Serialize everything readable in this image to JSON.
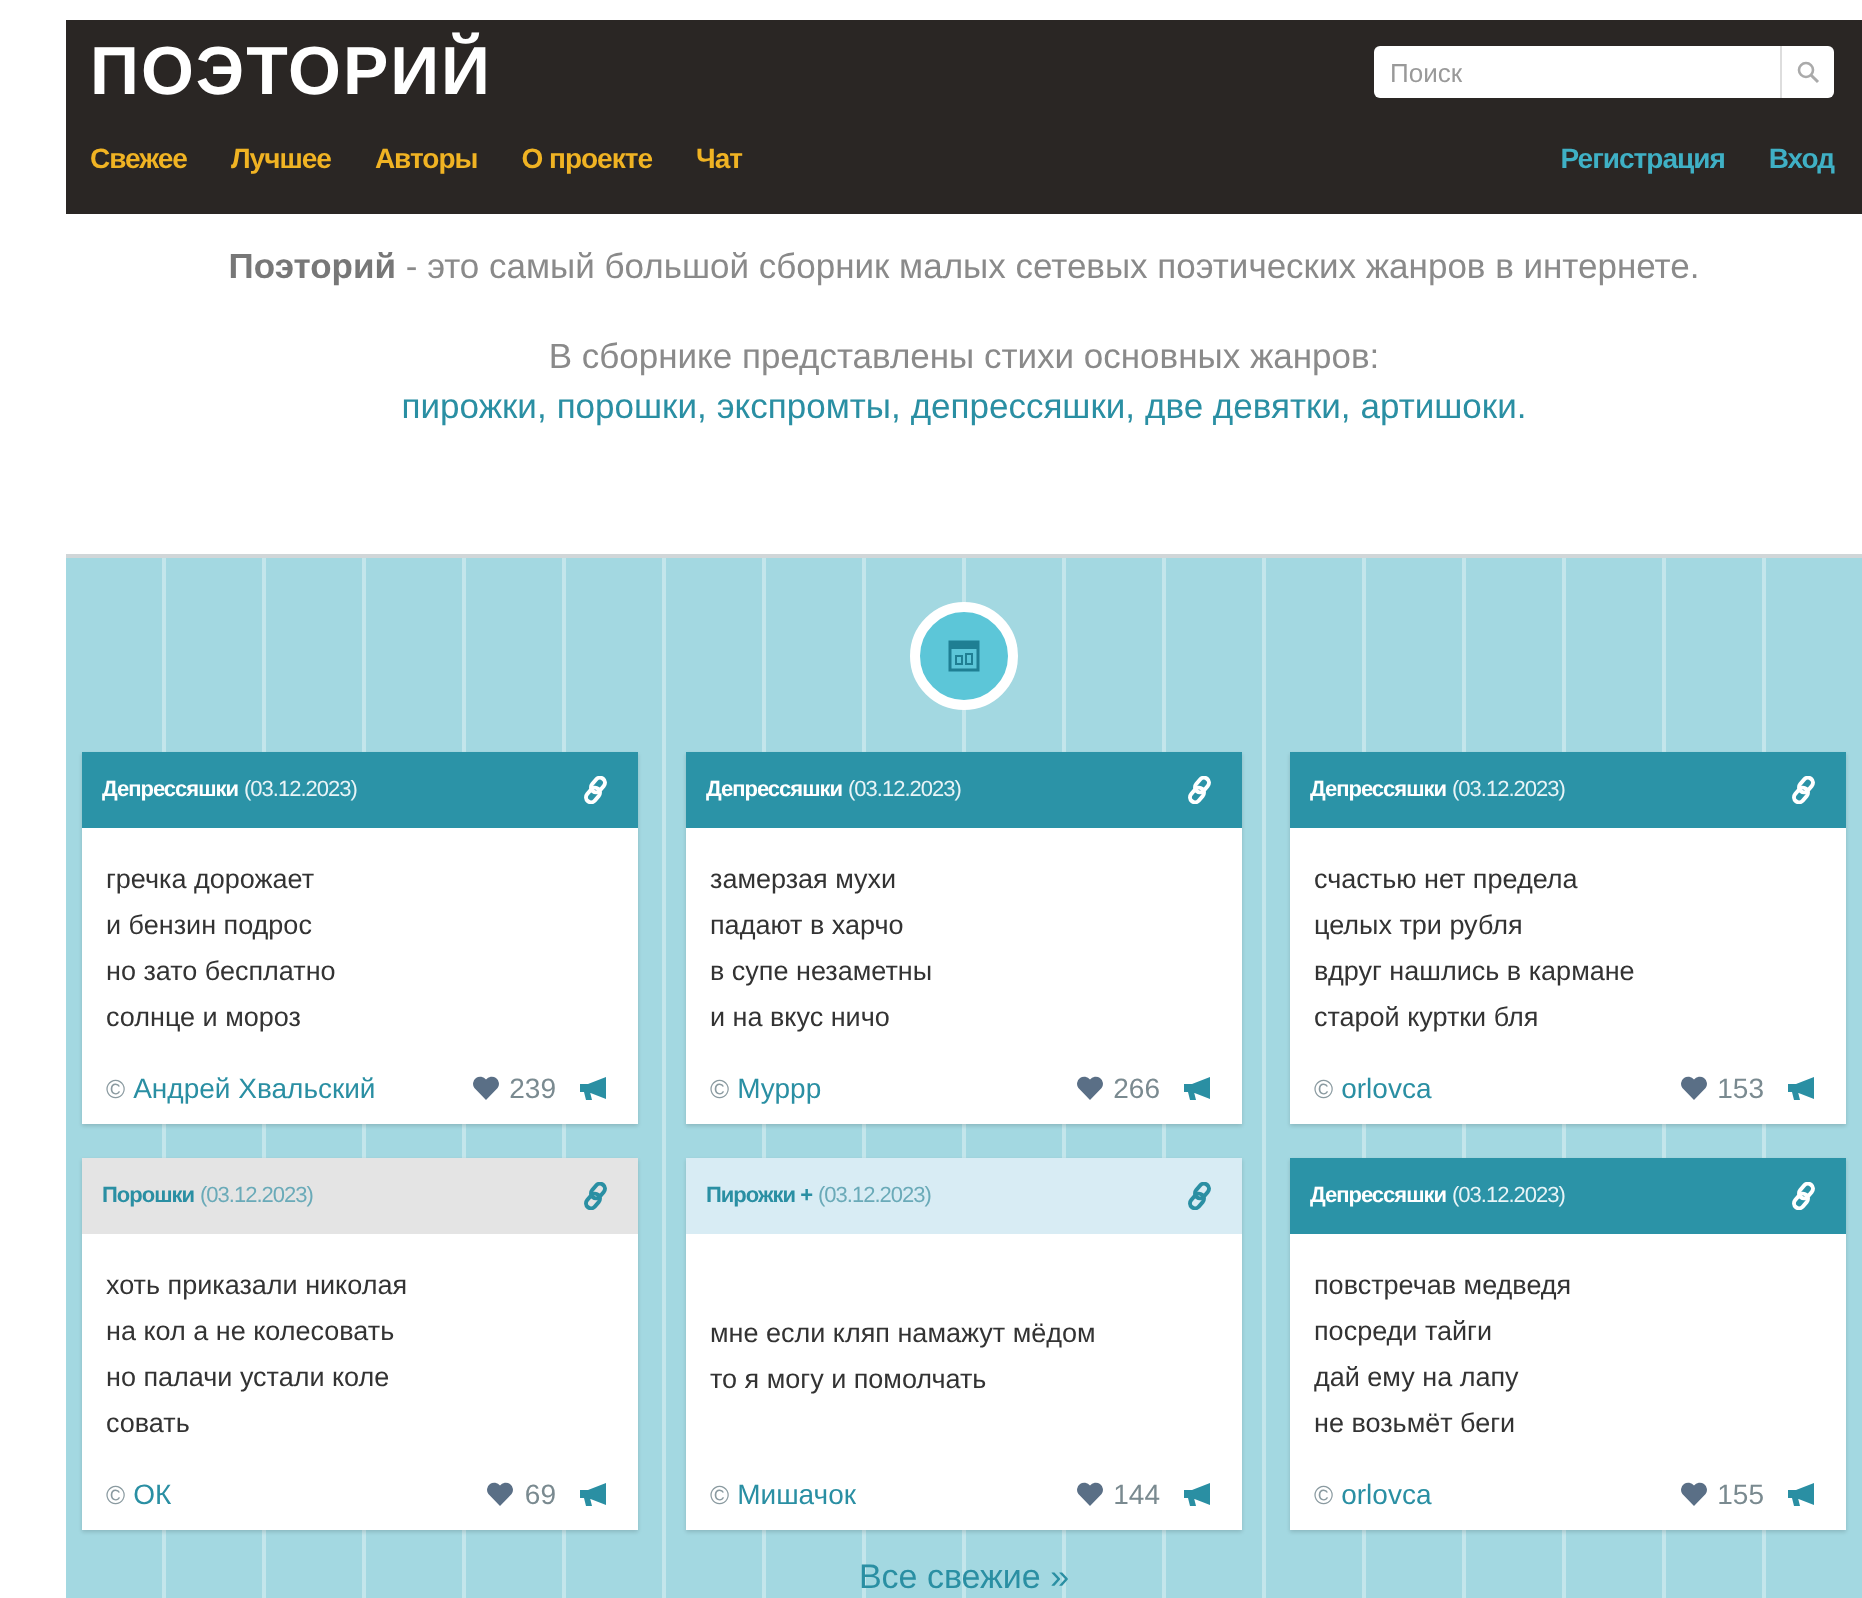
{
  "header": {
    "logo": "ПОЭТОРИЙ",
    "search": {
      "placeholder": "Поиск"
    },
    "nav": [
      {
        "label": "Свежее"
      },
      {
        "label": "Лучшее"
      },
      {
        "label": "Авторы"
      },
      {
        "label": "О проекте"
      },
      {
        "label": "Чат"
      }
    ],
    "account": [
      {
        "label": "Регистрация"
      },
      {
        "label": "Вход"
      }
    ]
  },
  "intro": {
    "text": "**Поэторий** - это самый большой сборник малых сетевых поэтических жанров в интернете.",
    "genres_caption": "В сборнике представлены стихи основных жанров:",
    "genres": [
      "пирожки,",
      "порошки,",
      "экспромты,",
      "депрессяшки,",
      "две девятки,",
      "артишоки."
    ]
  },
  "cards": [
    {
      "kind": "dark",
      "genre": "Депрессяшки",
      "date": "(03.12.2023)",
      "lines": [
        "гречка дорожает",
        "и бензин подрос",
        "но зато бесплатно",
        "солнце и мороз"
      ],
      "copyright": "©",
      "author": "Андрей Хвальский",
      "likes": "239"
    },
    {
      "kind": "dark",
      "genre": "Депрессяшки",
      "date": "(03.12.2023)",
      "lines": [
        "замерзая мухи",
        "падают в харчо",
        "в супе незаметны",
        "и на вкус ничо"
      ],
      "copyright": "©",
      "author": "Муррр",
      "likes": "266"
    },
    {
      "kind": "dark",
      "genre": "Депрессяшки",
      "date": "(03.12.2023)",
      "lines": [
        "счастью нет предела",
        "целых три рубля",
        "вдруг нашлись в кармане",
        "старой куртки бля"
      ],
      "copyright": "©",
      "author": "orlovca",
      "likes": "153"
    },
    {
      "kind": "grey",
      "genre": "Порошки",
      "date": "(03.12.2023)",
      "lines": [
        "хоть приказали николая",
        "на кол а не колесовать",
        "но палачи устали коле",
        "совать"
      ],
      "copyright": "©",
      "author": "ОК",
      "likes": "69"
    },
    {
      "kind": "light",
      "genre": "Пирожки +",
      "date": "(03.12.2023)",
      "lines": [
        "мне если кляп намажут мёдом",
        "то я могу и помолчать"
      ],
      "copyright": "©",
      "author": "Мишачок",
      "likes": "144"
    },
    {
      "kind": "dark",
      "genre": "Депрессяшки",
      "date": "(03.12.2023)",
      "lines": [
        "повстречав медведя",
        "посреди тайги",
        "дай ему на лапу",
        "не возьмёт беги"
      ],
      "copyright": "©",
      "author": "orlovca",
      "likes": "155"
    }
  ],
  "more_link": "Все свежие »"
}
